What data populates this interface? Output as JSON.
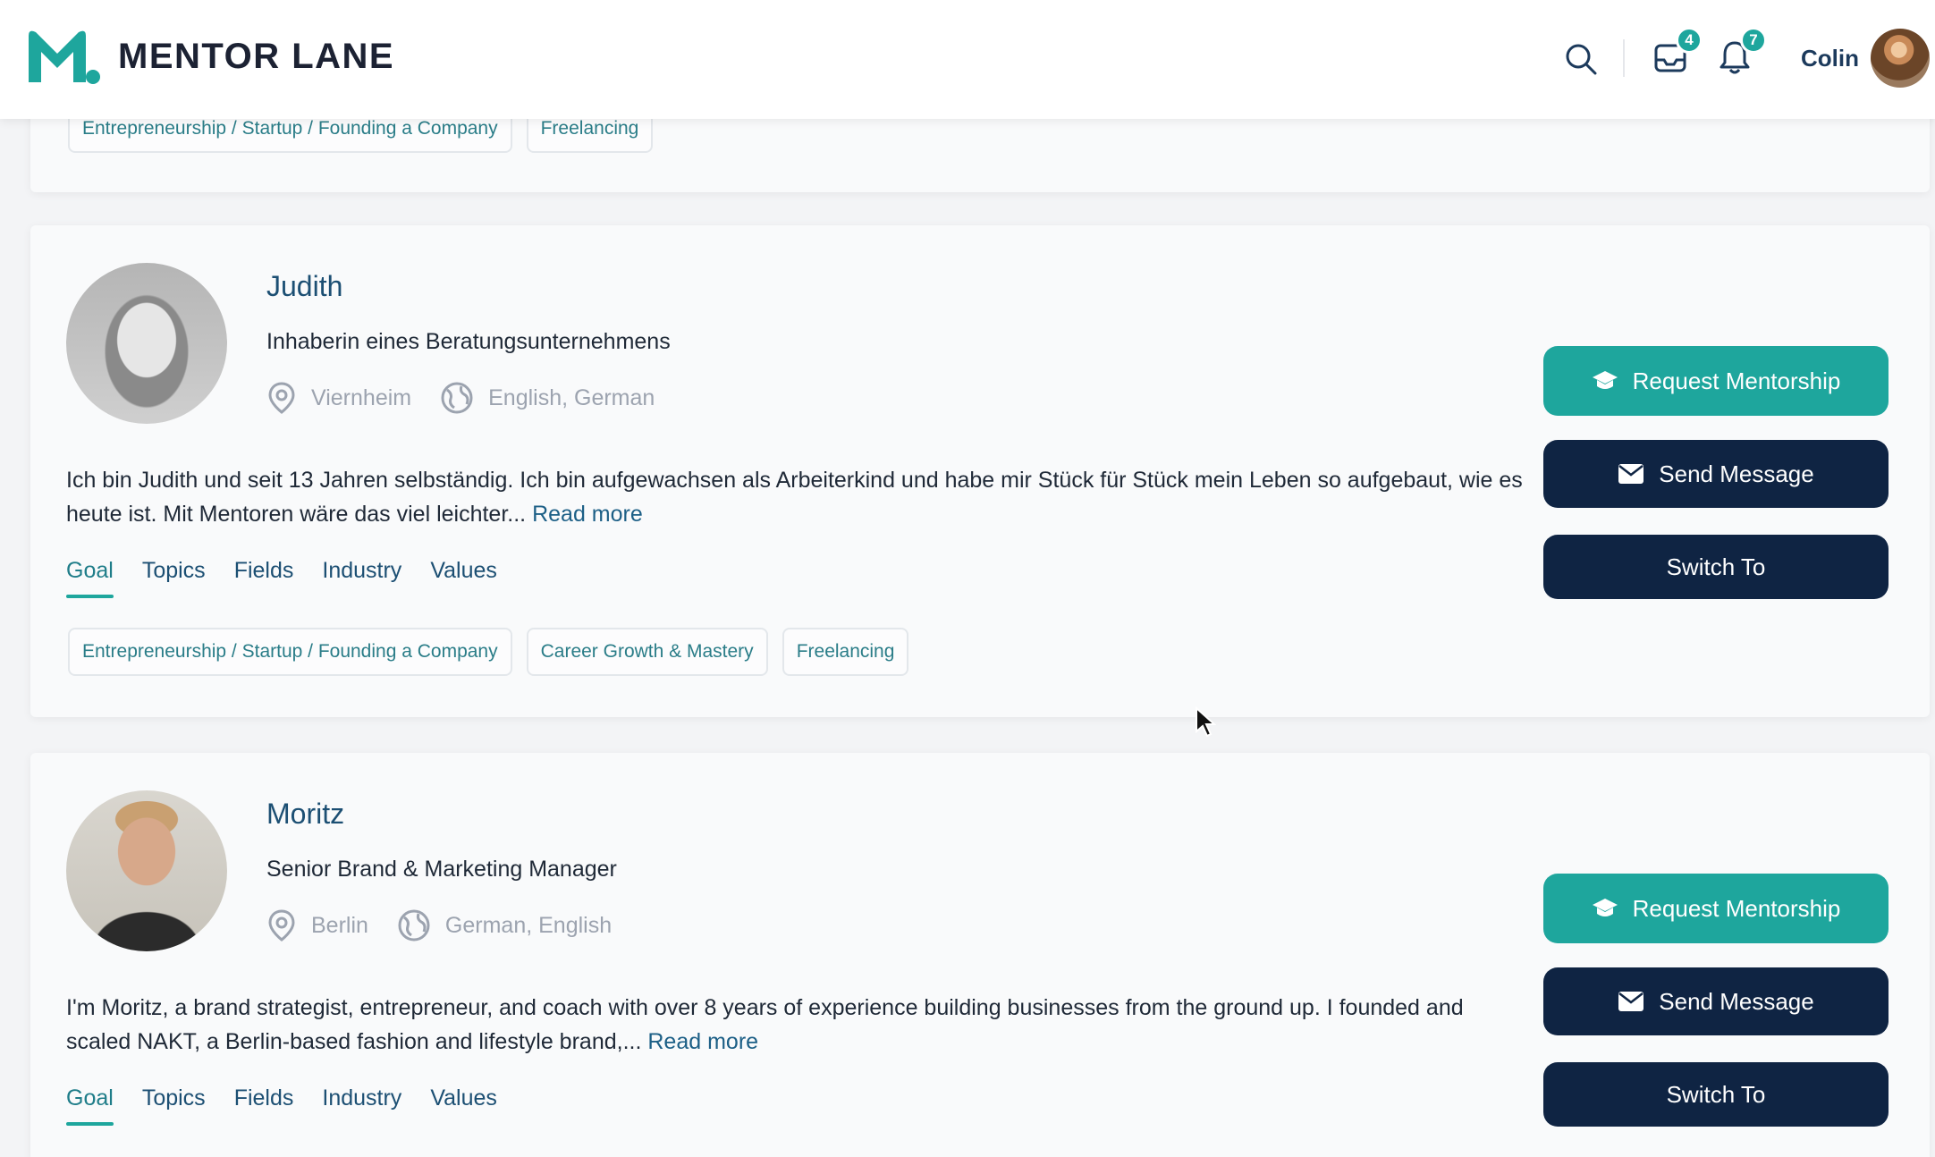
{
  "app": {
    "name": "MENTOR LANE"
  },
  "header": {
    "inbox_count": "4",
    "notification_count": "7",
    "user_name": "Colin"
  },
  "colors": {
    "brand_teal": "#1ea69d",
    "navy": "#0f2443",
    "link_blue": "#1c5f86"
  },
  "icons": [
    "search-icon",
    "inbox-icon",
    "bell-icon",
    "location-pin-icon",
    "globe-icon",
    "graduation-cap-icon",
    "envelope-icon"
  ],
  "top_card": {
    "tags": [
      "Entrepreneurship / Startup / Founding a Company",
      "Freelancing"
    ]
  },
  "mentors": [
    {
      "name": "Judith",
      "title": "Inhaberin eines Beratungsunternehmens",
      "location": "Viernheim",
      "languages": "English, German",
      "bio": "Ich bin Judith und seit 13 Jahren selbständig. Ich bin aufgewachsen als Arbeiterkind und habe mir Stück für Stück mein Leben so aufgebaut, wie es heute ist. Mit Mentoren wäre das viel leichter...",
      "read_more": "Read more",
      "tabs": [
        "Goal",
        "Topics",
        "Fields",
        "Industry",
        "Values"
      ],
      "active_tab": "Goal",
      "tags": [
        "Entrepreneurship / Startup / Founding a Company",
        "Career Growth & Mastery",
        "Freelancing"
      ],
      "buttons": {
        "request": "Request Mentorship",
        "message": "Send Message",
        "switch": "Switch To"
      }
    },
    {
      "name": "Moritz",
      "title": "Senior Brand & Marketing Manager",
      "location": "Berlin",
      "languages": "German, English",
      "bio": "I'm Moritz, a brand strategist, entrepreneur, and coach with over 8 years of experience building businesses from the ground up. I founded and scaled NAKT, a Berlin-based fashion and lifestyle brand,...",
      "read_more": "Read more",
      "tabs": [
        "Goal",
        "Topics",
        "Fields",
        "Industry",
        "Values"
      ],
      "active_tab": "Goal",
      "buttons": {
        "request": "Request Mentorship",
        "message": "Send Message",
        "switch": "Switch To"
      }
    }
  ]
}
